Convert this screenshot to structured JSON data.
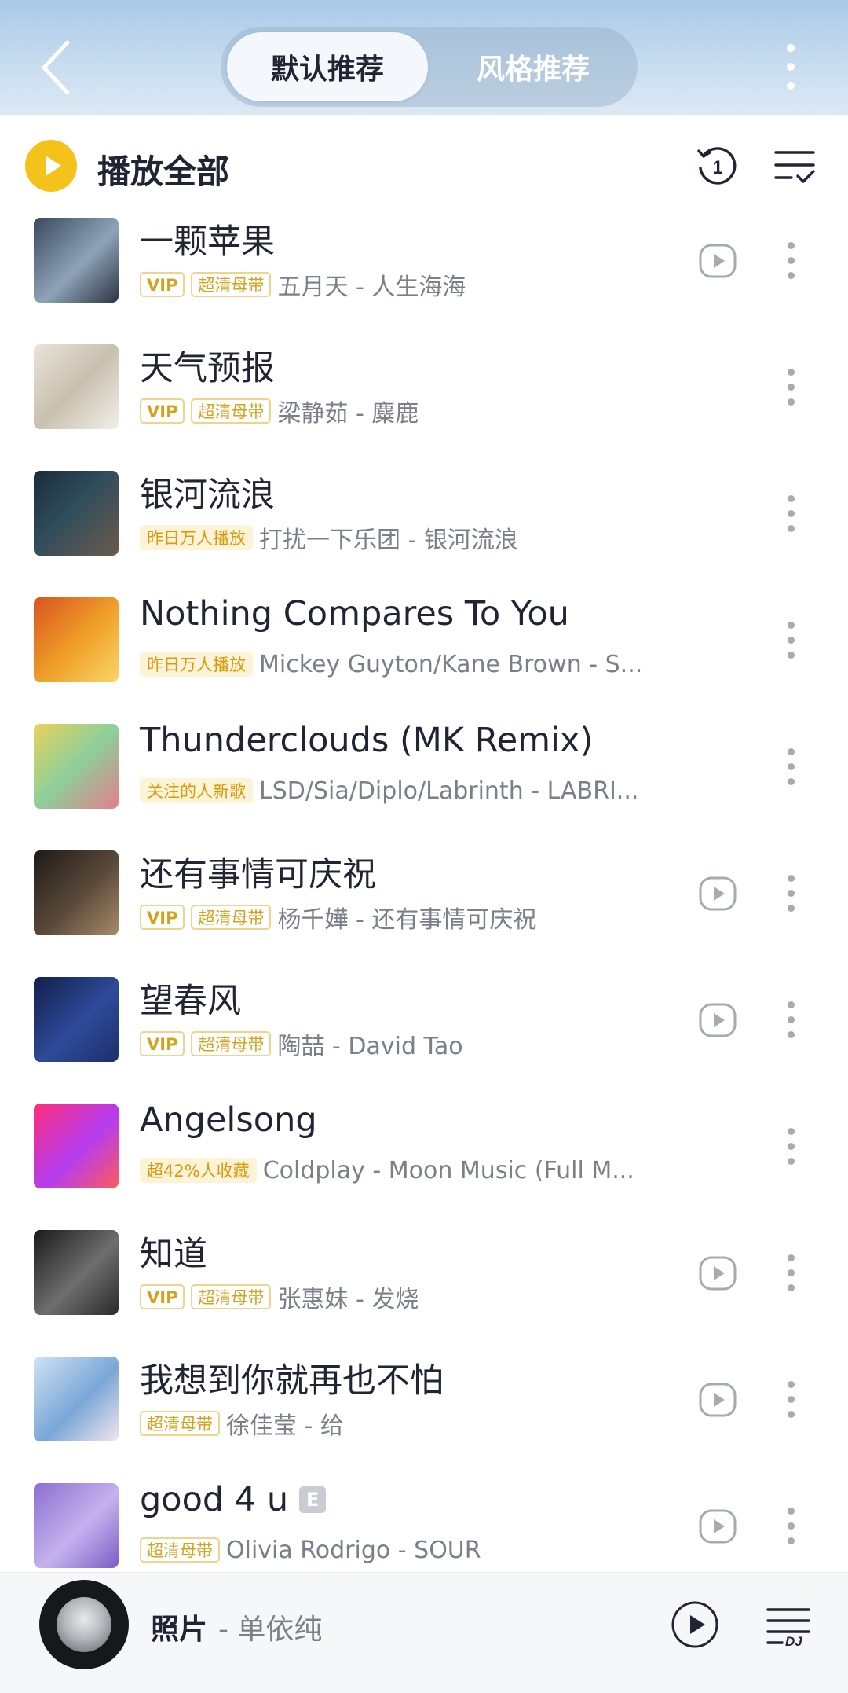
{
  "header": {
    "tabs": [
      {
        "label": "默认推荐",
        "active": true
      },
      {
        "label": "风格推荐",
        "active": false
      }
    ]
  },
  "toolbar": {
    "play_all_label": "播放全部",
    "replay_badge": "1"
  },
  "songs": [
    {
      "title": "一颗苹果",
      "tags": [
        "VIP",
        "超清母带"
      ],
      "artist_album": "五月天 - 人生海海",
      "has_play": true
    },
    {
      "title": "天气预报",
      "tags": [
        "VIP",
        "超清母带"
      ],
      "artist_album": "梁静茹 - 麋鹿",
      "has_play": false
    },
    {
      "title": "银河流浪",
      "tags": [
        "昨日万人播放"
      ],
      "artist_album": "打扰一下乐团 - 银河流浪",
      "has_play": false
    },
    {
      "title": "Nothing Compares To You",
      "tags": [
        "昨日万人播放"
      ],
      "artist_album": "Mickey Guyton/Kane Brown - S...",
      "has_play": false
    },
    {
      "title": "Thunderclouds (MK Remix)",
      "tags": [
        "关注的人新歌"
      ],
      "artist_album": "LSD/Sia/Diplo/Labrinth - LABRI...",
      "has_play": false
    },
    {
      "title": "还有事情可庆祝",
      "tags": [
        "VIP",
        "超清母带"
      ],
      "artist_album": "杨千嬅 - 还有事情可庆祝",
      "has_play": true
    },
    {
      "title": "望春风",
      "tags": [
        "VIP",
        "超清母带"
      ],
      "artist_album": "陶喆 - David Tao",
      "has_play": true
    },
    {
      "title": "Angelsong",
      "tags": [
        "超42%人收藏"
      ],
      "artist_album": "Coldplay - Moon Music (Full M...",
      "has_play": false
    },
    {
      "title": "知道",
      "tags": [
        "VIP",
        "超清母带"
      ],
      "artist_album": "张惠妹 - 发烧",
      "has_play": true
    },
    {
      "title": "我想到你就再也不怕",
      "tags": [
        "超清母带"
      ],
      "artist_album": "徐佳莹 - 给",
      "has_play": true
    },
    {
      "title": "good 4 u",
      "tags": [
        "超清母带"
      ],
      "artist_album": "Olivia Rodrigo - SOUR",
      "has_play": true,
      "explicit": "E"
    }
  ],
  "now_playing": {
    "title": "照片",
    "artist": "- 单依纯",
    "list_label": "DJ"
  },
  "colors": {
    "accent": "#f4c21b",
    "tag_gold": "#d6a21e",
    "header_bg": "#b9d3ec"
  }
}
